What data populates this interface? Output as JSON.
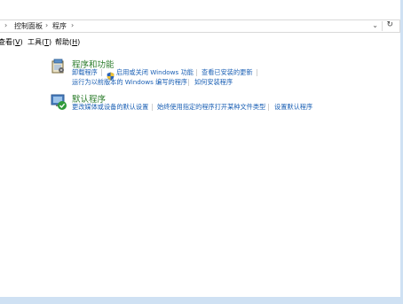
{
  "address": {
    "crumbs": [
      "控制面板",
      "程序"
    ],
    "refresh_icon": "refresh-icon"
  },
  "menu": {
    "items": [
      {
        "label": "查看",
        "key": "V"
      },
      {
        "label": "工具",
        "key": "T"
      },
      {
        "label": "帮助",
        "key": "H"
      }
    ]
  },
  "categories": [
    {
      "title": "程序和功能",
      "icon": "programs-features-icon",
      "links_row1": [
        "卸载程序",
        "启用或关闭 Windows 功能",
        "查看已安装的更新"
      ],
      "links_row2": [
        "运行为以前版本的 Windows 编写的程序",
        "如何安装程序"
      ]
    },
    {
      "title": "默认程序",
      "icon": "default-programs-icon",
      "links_row1": [
        "更改媒体或设备的默认设置",
        "始终使用指定的程序打开某种文件类型",
        "设置默认程序"
      ]
    }
  ],
  "colors": {
    "title_green": "#2d7d2d",
    "link_blue": "#1a5fb4"
  }
}
